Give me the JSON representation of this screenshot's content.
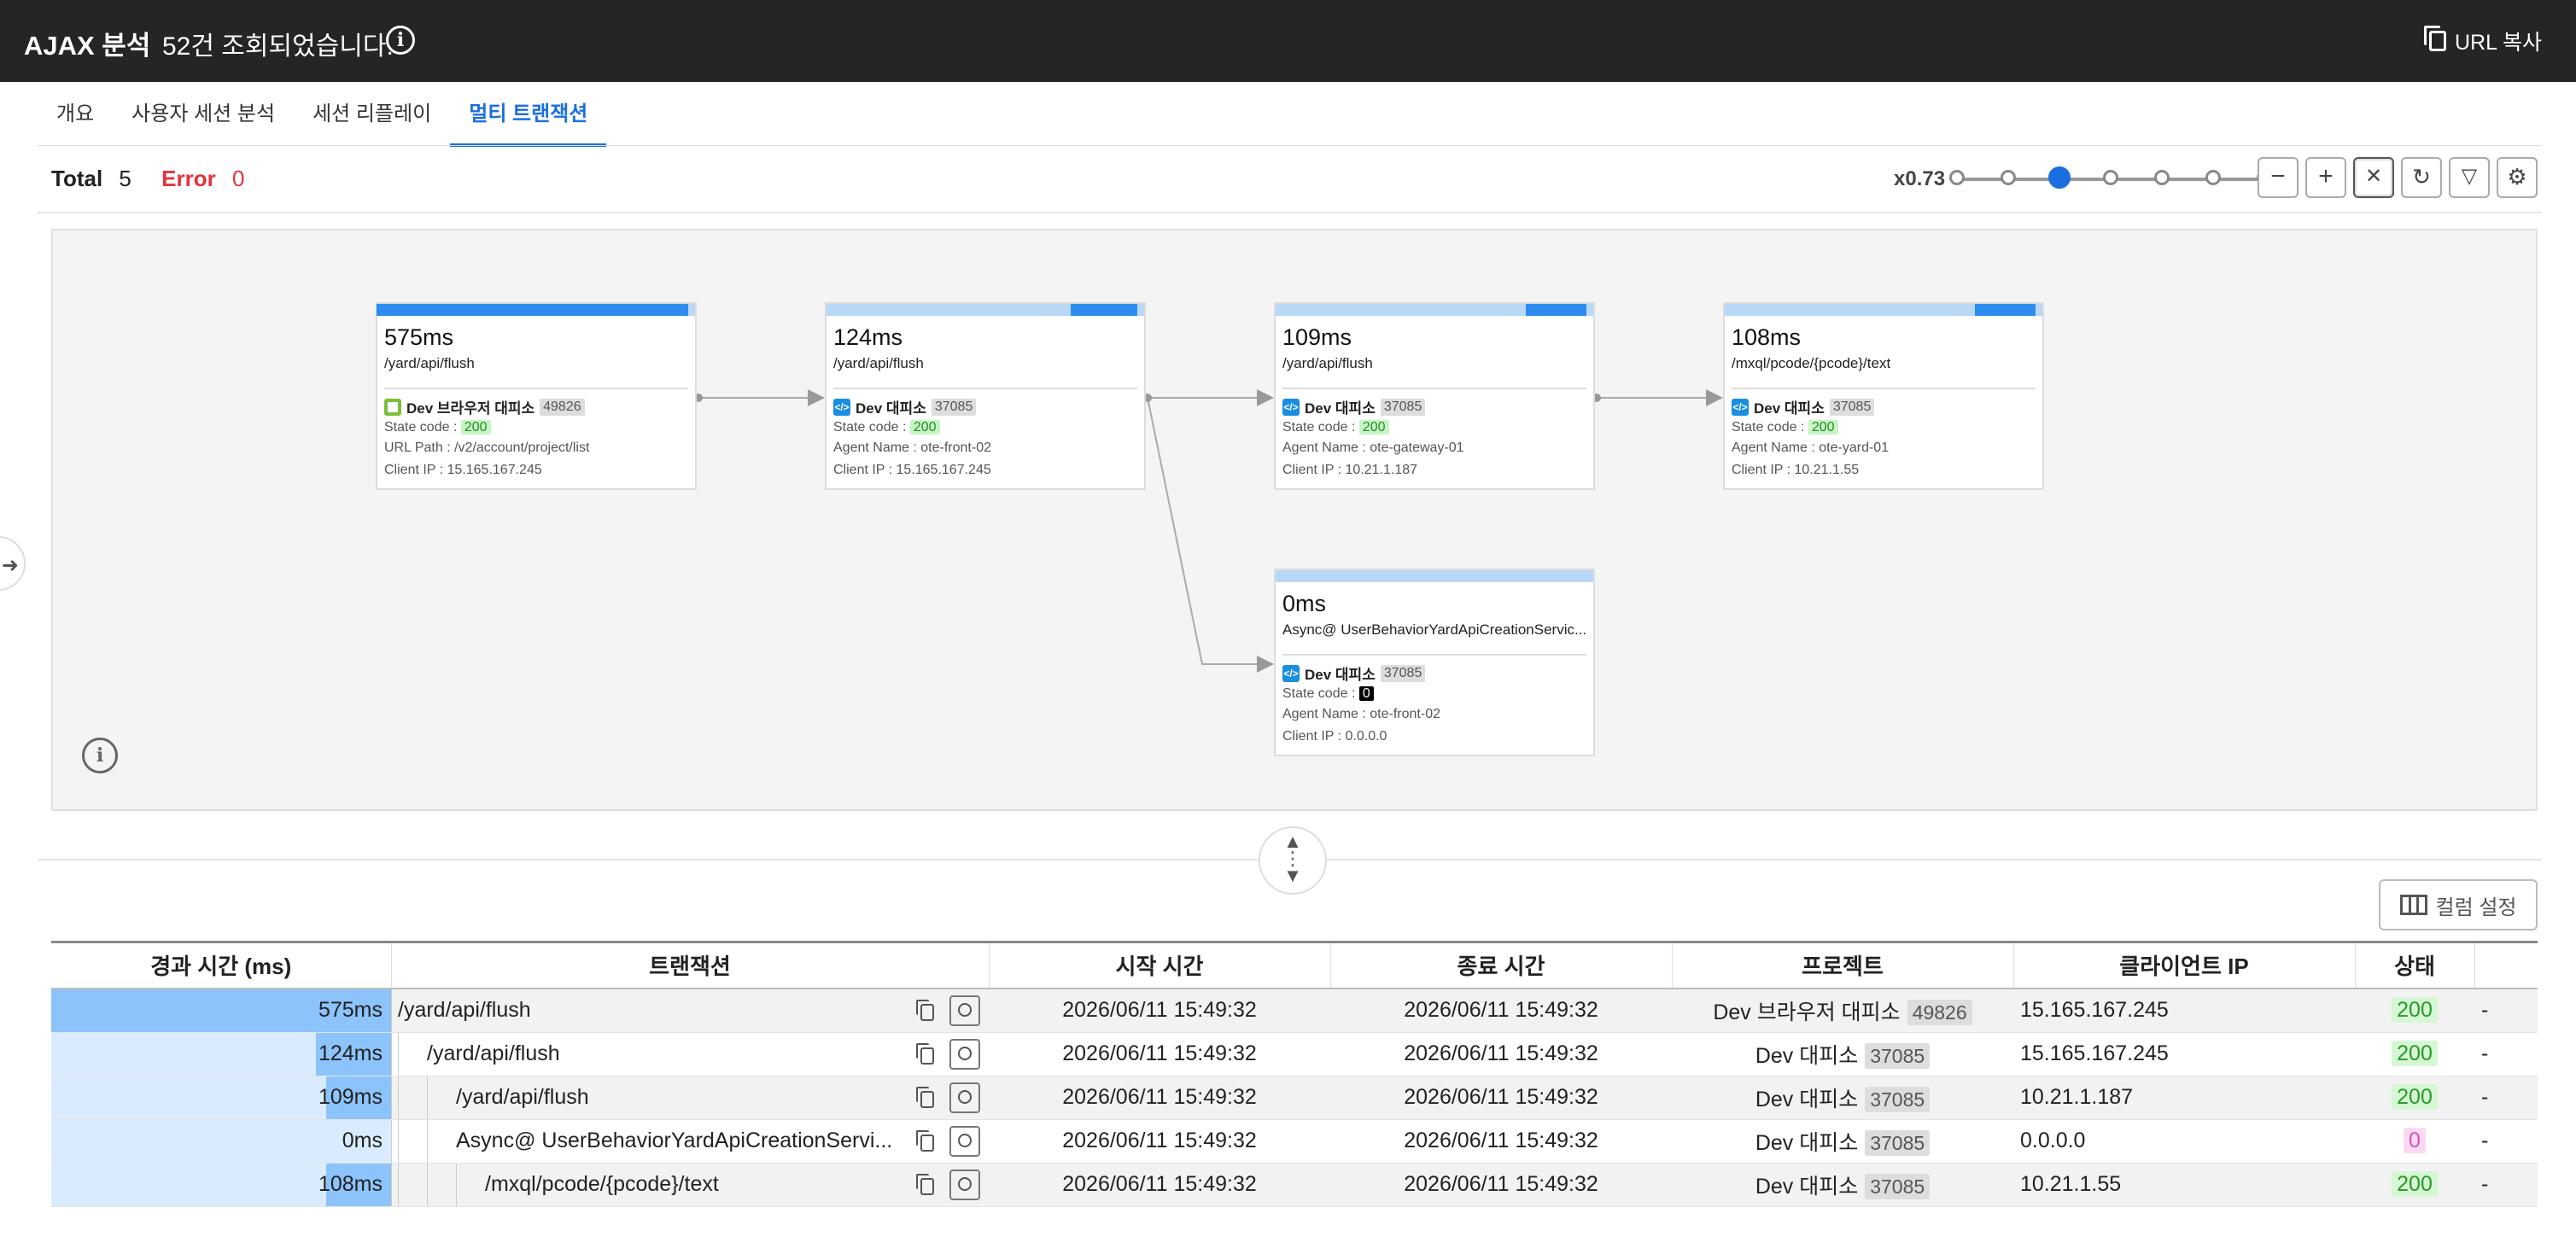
{
  "header": {
    "title": "AJAX 분석",
    "subtitle": "52건 조회되었습니다.",
    "info_icon": "info-icon",
    "url_copy": "URL 복사"
  },
  "tabs": [
    {
      "label": "개요"
    },
    {
      "label": "사용자 세션 분석"
    },
    {
      "label": "세션 리플레이"
    },
    {
      "label": "멀티 트랜잭션",
      "active": true
    }
  ],
  "toolbar": {
    "total_label": "Total",
    "total_value": "5",
    "error_label": "Error",
    "error_value": "0",
    "zoom_label": "x0.73",
    "zoom_steps": 7,
    "zoom_selected_index": 2
  },
  "nodes": [
    {
      "ms": "575ms",
      "path": "/yard/api/flush",
      "project": "Dev 브라우저 대피소",
      "project_id": "49826",
      "icon": "browser-icon",
      "state_label": "State code : ",
      "state": "200",
      "line3": "URL Path : /v2/account/project/list",
      "line4": "Client IP : 15.165.167.245",
      "fill_fraction": 0.98
    },
    {
      "ms": "124ms",
      "path": "/yard/api/flush",
      "project": "Dev 대피소",
      "project_id": "37085",
      "icon": "code-icon",
      "state_label": "State code : ",
      "state": "200",
      "line3": "Agent Name : ote-front-02",
      "line4": "Client IP : 15.165.167.245",
      "fill_fraction": 0.21
    },
    {
      "ms": "109ms",
      "path": "/yard/api/flush",
      "project": "Dev 대피소",
      "project_id": "37085",
      "icon": "code-icon",
      "state_label": "State code : ",
      "state": "200",
      "line3": "Agent Name : ote-gateway-01",
      "line4": "Client IP : 10.21.1.187",
      "fill_fraction": 0.19
    },
    {
      "ms": "108ms",
      "path": "/mxql/pcode/{pcode}/text",
      "project": "Dev 대피소",
      "project_id": "37085",
      "icon": "code-icon",
      "state_label": "State code : ",
      "state": "200",
      "line3": "Agent Name : ote-yard-01",
      "line4": "Client IP : 10.21.1.55",
      "fill_fraction": 0.19
    },
    {
      "ms": "0ms",
      "path": "Async@ UserBehaviorYardApiCreationServic...",
      "project": "Dev 대피소",
      "project_id": "37085",
      "icon": "code-icon",
      "state_label": "State code : ",
      "state": "0",
      "line3": "Agent Name : ote-front-02",
      "line4": "Client IP : 0.0.0.0",
      "fill_fraction": 0.0
    }
  ],
  "column_settings": "컬럼 설정",
  "table": {
    "headers": [
      "경과 시간 (ms)",
      "트랜잭션",
      "시작 시간",
      "종료 시간",
      "프로젝트",
      "클라이언트 IP",
      "상태"
    ],
    "rows": [
      {
        "elapsed": "575ms",
        "elapsed_fraction": 1.0,
        "depth": 0,
        "tx": "/yard/api/flush",
        "start": "2026/06/11 15:49:32",
        "end": "2026/06/11 15:49:32",
        "project": "Dev 브라우저 대피소",
        "pid": "49826",
        "ip": "15.165.167.245",
        "status": "200",
        "extra": "-"
      },
      {
        "elapsed": "124ms",
        "elapsed_fraction": 0.22,
        "depth": 1,
        "tx": "/yard/api/flush",
        "start": "2026/06/11 15:49:32",
        "end": "2026/06/11 15:49:32",
        "project": "Dev 대피소",
        "pid": "37085",
        "ip": "15.165.167.245",
        "status": "200",
        "extra": "-"
      },
      {
        "elapsed": "109ms",
        "elapsed_fraction": 0.19,
        "depth": 2,
        "tx": "/yard/api/flush",
        "start": "2026/06/11 15:49:32",
        "end": "2026/06/11 15:49:32",
        "project": "Dev 대피소",
        "pid": "37085",
        "ip": "10.21.1.187",
        "status": "200",
        "extra": "-"
      },
      {
        "elapsed": "0ms",
        "elapsed_fraction": 0.0,
        "depth": 2,
        "tx": "Async@ UserBehaviorYardApiCreationServi...",
        "start": "2026/06/11 15:49:32",
        "end": "2026/06/11 15:49:32",
        "project": "Dev 대피소",
        "pid": "37085",
        "ip": "0.0.0.0",
        "status": "0",
        "extra": "-"
      },
      {
        "elapsed": "108ms",
        "elapsed_fraction": 0.19,
        "depth": 3,
        "tx": "/mxql/pcode/{pcode}/text",
        "start": "2026/06/11 15:49:32",
        "end": "2026/06/11 15:49:32",
        "project": "Dev 대피소",
        "pid": "37085",
        "ip": "10.21.1.55",
        "status": "200",
        "extra": "-"
      }
    ]
  }
}
